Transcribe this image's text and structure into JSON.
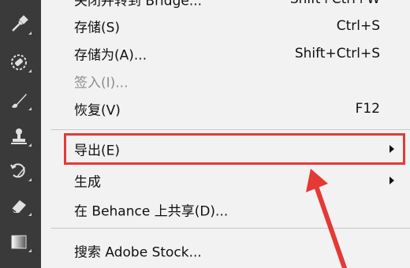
{
  "menu": {
    "items": [
      {
        "label": "关闭并转到 Bridge...",
        "shortcut": "Shift+Ctrl+W",
        "disabled": false,
        "submenu": false
      },
      {
        "label": "存储(S)",
        "shortcut": "Ctrl+S",
        "disabled": false,
        "submenu": false
      },
      {
        "label": "存储为(A)...",
        "shortcut": "Shift+Ctrl+S",
        "disabled": false,
        "submenu": false
      },
      {
        "label": "签入(I)...",
        "shortcut": "",
        "disabled": true,
        "submenu": false
      },
      {
        "label": "恢复(V)",
        "shortcut": "F12",
        "disabled": false,
        "submenu": false
      },
      {
        "label": "导出(E)",
        "shortcut": "",
        "disabled": false,
        "submenu": true
      },
      {
        "label": "生成",
        "shortcut": "",
        "disabled": false,
        "submenu": true
      },
      {
        "label": "在 Behance 上共享(D)...",
        "shortcut": "",
        "disabled": false,
        "submenu": false
      },
      {
        "label": "搜索 Adobe Stock...",
        "shortcut": "",
        "disabled": false,
        "submenu": false
      }
    ]
  },
  "toolbar": {
    "tools": [
      "eyedropper-icon",
      "spot-healing-brush-icon",
      "brush-icon",
      "clone-stamp-icon",
      "history-brush-icon",
      "eraser-icon",
      "gradient-icon"
    ]
  },
  "annotation": {
    "highlight_color": "#e53935",
    "highlighted_item": "导出(E)"
  }
}
